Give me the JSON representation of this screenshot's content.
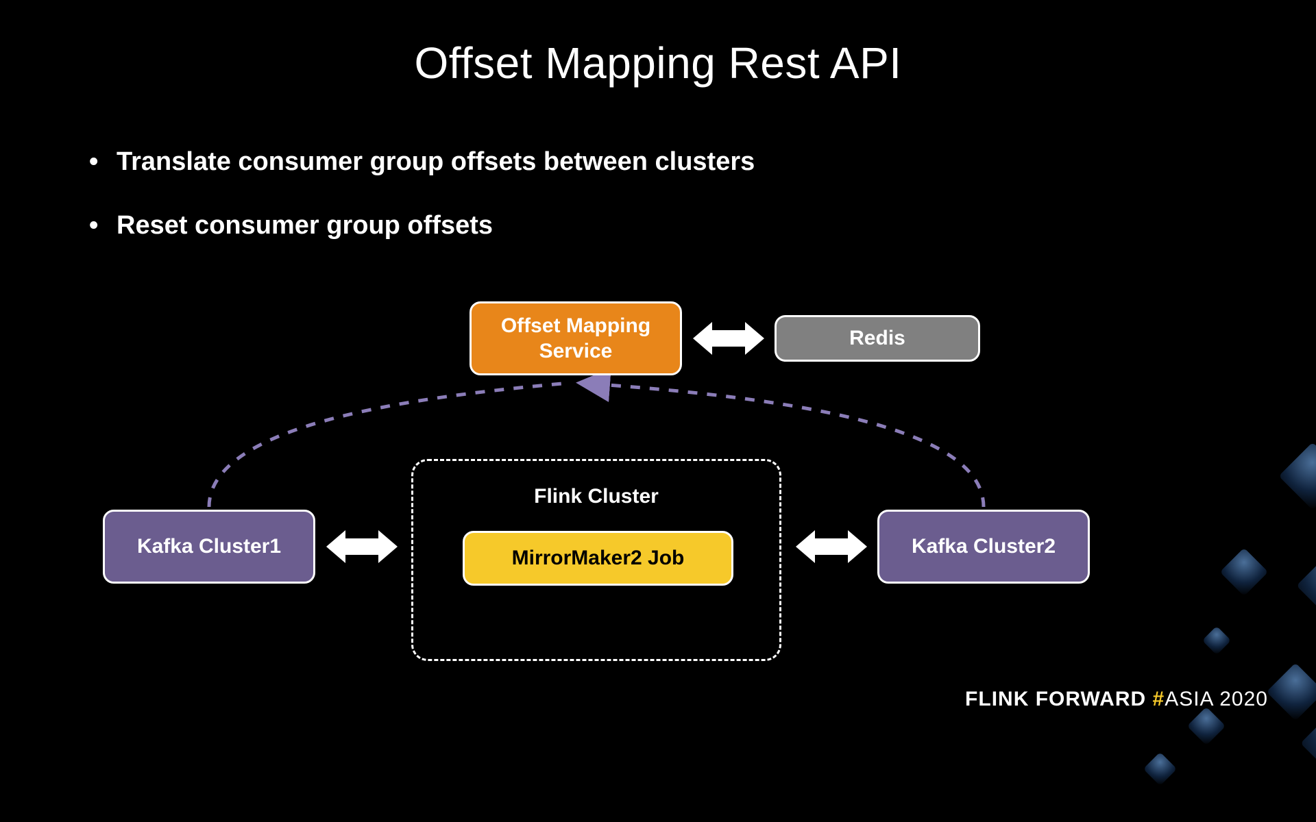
{
  "title": "Offset Mapping Rest API",
  "bullets": [
    "Translate consumer group offsets between clusters",
    "Reset consumer group offsets"
  ],
  "boxes": {
    "oms": "Offset Mapping Service",
    "redis": "Redis",
    "kc1": "Kafka Cluster1",
    "kc2": "Kafka Cluster2",
    "mm2": "MirrorMaker2 Job",
    "flink_cluster_label": "Flink Cluster"
  },
  "footer": {
    "flink": "FLINK",
    "forward": "FORWARD",
    "hash": "#",
    "asia": "ASIA 2020"
  },
  "colors": {
    "orange": "#e8861a",
    "grey": "#808080",
    "purple": "#6b5d8f",
    "yellow": "#f6c92a",
    "dashed_line": "#8b7db8"
  }
}
